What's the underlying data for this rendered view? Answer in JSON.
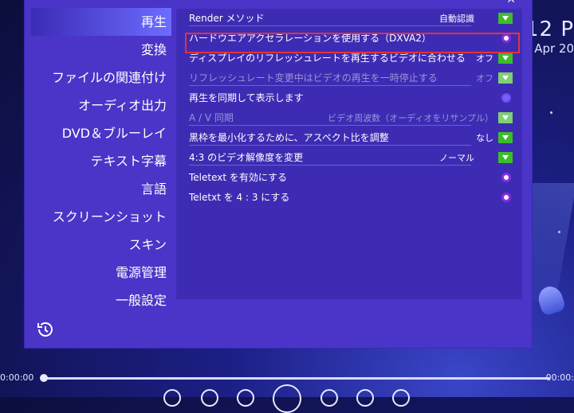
{
  "clock": {
    "time": "12 P",
    "date": "Apr 20"
  },
  "window": {
    "close_glyph": "✕"
  },
  "nav": {
    "items": [
      {
        "label": "再生",
        "active": true
      },
      {
        "label": "変換"
      },
      {
        "label": "ファイルの関連付け"
      },
      {
        "label": "オーディオ出力"
      },
      {
        "label": "DVD＆ブルーレイ"
      },
      {
        "label": "テキスト字幕"
      },
      {
        "label": "言語"
      },
      {
        "label": "スクリーンショット"
      },
      {
        "label": "スキン"
      },
      {
        "label": "電源管理"
      },
      {
        "label": "一般設定"
      }
    ],
    "history_icon": "history-icon"
  },
  "settings": {
    "rows": [
      {
        "label": "Render メソッド",
        "value": "自動認識",
        "control": "dropdown"
      },
      {
        "label": "ハードウエアアクセラレーションを使用する（DXVA2）",
        "control": "radio",
        "highlighted": true
      },
      {
        "label": "ディスプレイのリフレッシュレートを再生するビデオに合わせる",
        "value": "オフ",
        "control": "dropdown"
      },
      {
        "label": "リフレッシュレート変更中はビデオの再生を一時停止する",
        "value": "オフ",
        "control": "dropdown",
        "disabled": true
      },
      {
        "label": "再生を同期して表示します",
        "control": "radio_on"
      },
      {
        "label": "A / V 同期",
        "value": "ビデオ周波数（オーディオをリサンプル）",
        "control": "dropdown",
        "disabled": true
      },
      {
        "label": "黒枠を最小化するために、アスペクト比を調整",
        "value": "なし",
        "control": "dropdown"
      },
      {
        "label": "4:3 のビデオ解像度を変更",
        "value": "ノーマル",
        "control": "dropdown"
      },
      {
        "label": "Teletext を有効にする",
        "control": "radio"
      },
      {
        "label": "Teletxt を 4 : 3 にする",
        "control": "radio"
      }
    ]
  },
  "player": {
    "time_current": "0:00:00",
    "time_total": "00:00:",
    "progress": 0
  },
  "colors": {
    "panel": "#4a35c8",
    "content": "#3d2cb3",
    "accent_green": "#3dbd2a",
    "highlight_red": "#e8303a"
  }
}
